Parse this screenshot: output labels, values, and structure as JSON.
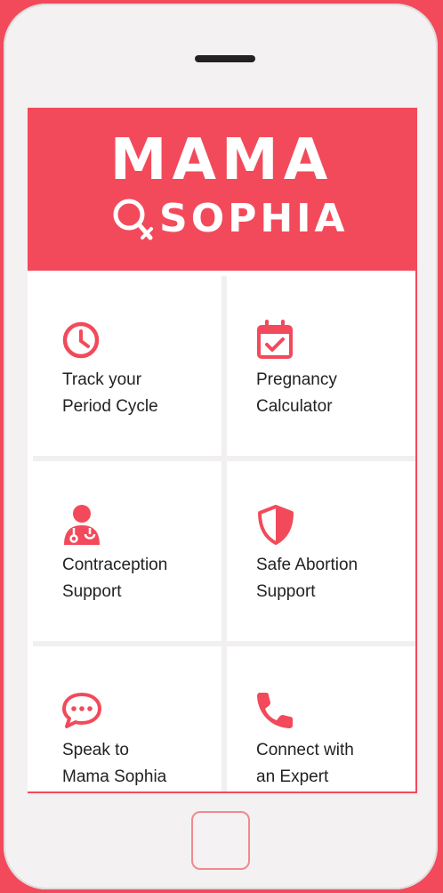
{
  "app": {
    "logo_top": "MAMA",
    "logo_bottom": "SOPHIA",
    "brand_color": "#f24a5b"
  },
  "tiles": [
    {
      "line1": "Track your",
      "line2": "Period Cycle",
      "icon": "clock-icon"
    },
    {
      "line1": "Pregnancy",
      "line2": "Calculator",
      "icon": "calendar-check-icon"
    },
    {
      "line1": "Contraception",
      "line2": "Support",
      "icon": "doctor-icon"
    },
    {
      "line1": "Safe Abortion",
      "line2": "Support",
      "icon": "shield-icon"
    },
    {
      "line1": "Speak to",
      "line2": "Mama Sophia",
      "icon": "chat-bubble-icon"
    },
    {
      "line1": "Connect with",
      "line2": "an Expert",
      "icon": "phone-icon"
    }
  ]
}
